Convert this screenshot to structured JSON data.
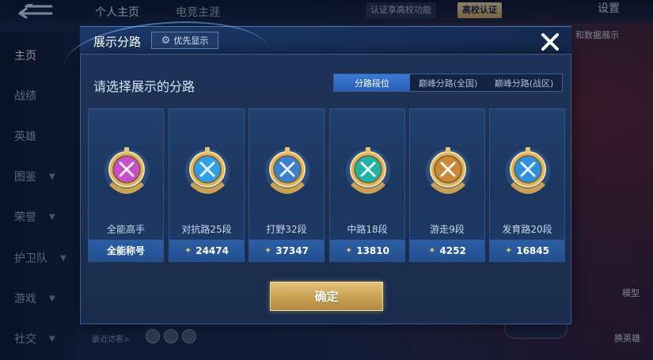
{
  "topbar": {
    "tabs": [
      "个人主页",
      "电竞主涯"
    ],
    "verify_text": "认证享高校功能",
    "verify_badge": "高校认证",
    "settings": "设置"
  },
  "sidebar": {
    "items": [
      {
        "label": "主页",
        "active": true
      },
      {
        "label": "战绩"
      },
      {
        "label": "英雄"
      },
      {
        "label": "图鉴"
      },
      {
        "label": "荣誉"
      },
      {
        "label": "护卫队"
      },
      {
        "label": "游戏"
      },
      {
        "label": "社交"
      }
    ]
  },
  "right_panel": {
    "data_tab": "和数据展示",
    "model_label": "模型",
    "switch_hero_label": "换英雄"
  },
  "visitors_label": "最近访客>",
  "modal": {
    "title": "展示分路",
    "priority_button": "优先显示",
    "subtitle": "请选择展示的分路",
    "tabs": [
      {
        "label": "分路段位",
        "active": true
      },
      {
        "label": "巅峰分路(全国)"
      },
      {
        "label": "巅峰分路(战区)"
      }
    ],
    "cards": [
      {
        "role": "全能高手",
        "score": "全能称号",
        "icon": "all-rounder-emblem-icon",
        "color": "#c64fc8"
      },
      {
        "role": "对抗路25段",
        "score": "24474",
        "icon": "clash-lane-emblem-icon",
        "color": "#2f9fe8"
      },
      {
        "role": "打野32段",
        "score": "37347",
        "icon": "jungle-emblem-icon",
        "color": "#3b7fd0"
      },
      {
        "role": "中路18段",
        "score": "13810",
        "icon": "mid-lane-emblem-icon",
        "color": "#22b1a6"
      },
      {
        "role": "游走9段",
        "score": "4252",
        "icon": "roam-emblem-icon",
        "color": "#c9883a"
      },
      {
        "role": "发育路20段",
        "score": "16845",
        "icon": "farm-lane-emblem-icon",
        "color": "#2d8fe0"
      }
    ],
    "confirm": "确定"
  }
}
